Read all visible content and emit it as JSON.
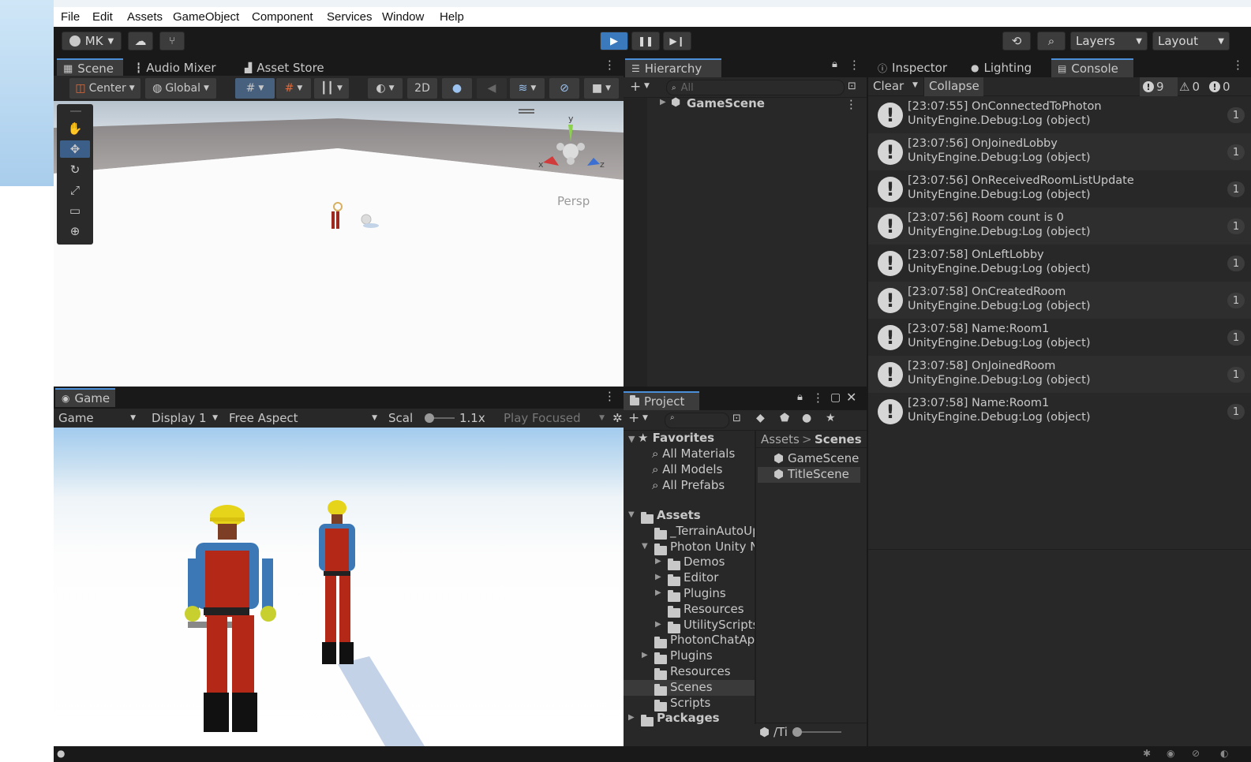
{
  "menubar": {
    "items": [
      "File",
      "Edit",
      "Assets",
      "GameObject",
      "Component",
      "Services",
      "Window",
      "Help"
    ]
  },
  "toolbar": {
    "account": "MK",
    "layers": "Layers",
    "layout": "Layout"
  },
  "scene_tabs": {
    "scene": "Scene",
    "audio_mixer": "Audio Mixer",
    "asset_store": "Asset Store"
  },
  "scene_toolbar": {
    "pivot": "Center",
    "space": "Global",
    "mode_2d": "2D",
    "persp": "Persp",
    "axis_x": "x",
    "axis_y": "y",
    "axis_z": "z"
  },
  "game": {
    "tab": "Game",
    "mode": "Game",
    "display": "Display 1",
    "aspect": "Free Aspect",
    "scale_label": "Scal",
    "scale_value": "1.1x",
    "play_focused": "Play Focused"
  },
  "hierarchy": {
    "tab": "Hierarchy",
    "search_placeholder": "All",
    "root": "GameScene"
  },
  "project": {
    "tab": "Project",
    "favorites": {
      "label": "Favorites",
      "items": [
        "All Materials",
        "All Models",
        "All Prefabs"
      ]
    },
    "tree": [
      {
        "label": "Assets",
        "depth": 0,
        "arrow": "open",
        "bold": true
      },
      {
        "label": "_TerrainAutoUp",
        "depth": 1,
        "arrow": ""
      },
      {
        "label": "Photon Unity N",
        "depth": 1,
        "arrow": "open"
      },
      {
        "label": "Demos",
        "depth": 2,
        "arrow": "closed"
      },
      {
        "label": "Editor",
        "depth": 2,
        "arrow": "closed"
      },
      {
        "label": "Plugins",
        "depth": 2,
        "arrow": "closed"
      },
      {
        "label": "Resources",
        "depth": 2,
        "arrow": ""
      },
      {
        "label": "UtilityScripts",
        "depth": 2,
        "arrow": "closed"
      },
      {
        "label": "PhotonChatApi",
        "depth": 1,
        "arrow": ""
      },
      {
        "label": "Plugins",
        "depth": 1,
        "arrow": "closed"
      },
      {
        "label": "Resources",
        "depth": 1,
        "arrow": ""
      },
      {
        "label": "Scenes",
        "depth": 1,
        "arrow": "",
        "selected": true
      },
      {
        "label": "Scripts",
        "depth": 1,
        "arrow": ""
      },
      {
        "label": "Packages",
        "depth": 0,
        "arrow": "closed",
        "bold": true
      }
    ],
    "breadcrumb": {
      "root": "Assets",
      "sep": ">",
      "current": "Scenes"
    },
    "files": [
      "GameScene",
      "TitleScene"
    ],
    "footer_path": "/Ti"
  },
  "inspector_tabs": {
    "inspector": "Inspector",
    "lighting": "Lighting",
    "console": "Console"
  },
  "console": {
    "clear": "Clear",
    "collapse": "Collapse",
    "counts": {
      "info": "9",
      "warn": "0",
      "error": "0"
    },
    "logs": [
      {
        "line1": "[23:07:55] OnConnectedToPhoton",
        "line2": "UnityEngine.Debug:Log (object)",
        "count": "1"
      },
      {
        "line1": "[23:07:56] OnJoinedLobby",
        "line2": "UnityEngine.Debug:Log (object)",
        "count": "1"
      },
      {
        "line1": "[23:07:56] OnReceivedRoomListUpdate",
        "line2": "UnityEngine.Debug:Log (object)",
        "count": "1"
      },
      {
        "line1": "[23:07:56] Room count is 0",
        "line2": "UnityEngine.Debug:Log (object)",
        "count": "1"
      },
      {
        "line1": "[23:07:58] OnLeftLobby",
        "line2": "UnityEngine.Debug:Log (object)",
        "count": "1"
      },
      {
        "line1": "[23:07:58] OnCreatedRoom",
        "line2": "UnityEngine.Debug:Log (object)",
        "count": "1"
      },
      {
        "line1": "[23:07:58] Name:Room1",
        "line2": "UnityEngine.Debug:Log (object)",
        "count": "1"
      },
      {
        "line1": "[23:07:58] OnJoinedRoom",
        "line2": "UnityEngine.Debug:Log (object)",
        "count": "1"
      },
      {
        "line1": "[23:07:58] Name:Room1",
        "line2": "UnityEngine.Debug:Log (object)",
        "count": "1"
      }
    ]
  },
  "colors": {
    "accent": "#4a8fd8",
    "selection": "#3c5f8a",
    "panel": "#282828",
    "chrome": "#191919"
  }
}
